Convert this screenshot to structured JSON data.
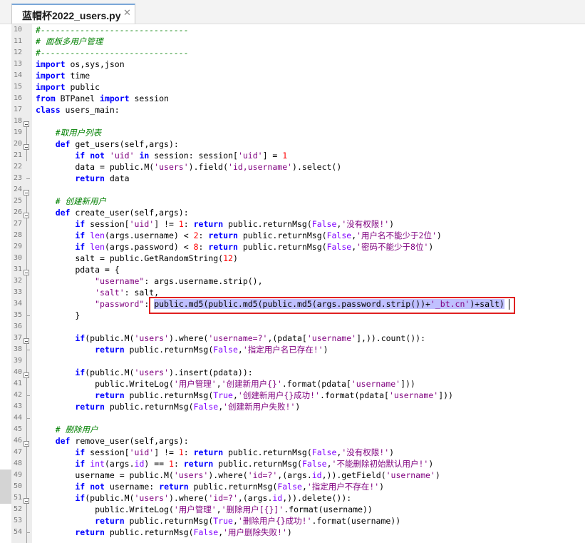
{
  "tab": {
    "title": "蓝帽杯2022_users.py",
    "close_glyph": "✕"
  },
  "gutter": {
    "line_numbers": [
      "10",
      "11",
      "12",
      "13",
      "14",
      "15",
      "16",
      "17",
      "18",
      "19",
      "20",
      "21",
      "22",
      "23",
      "24",
      "25",
      "26",
      "27",
      "28",
      "29",
      "30",
      "31",
      "32",
      "33",
      "34",
      "35",
      "36",
      "37",
      "38",
      "39",
      "40",
      "41",
      "42",
      "43",
      "44",
      "45",
      "46",
      "47",
      "48",
      "49",
      "50",
      "51",
      "52",
      "53",
      "54"
    ]
  },
  "code": {
    "l10": "#------------------------------",
    "l11": "# 面板多用户管理",
    "l12": "#------------------------------",
    "l13a": "import",
    "l13b": " os,sys,json",
    "l14a": "import",
    "l14b": " time",
    "l15a": "import",
    "l15b": " public",
    "l16a": "from",
    "l16b": " BTPanel ",
    "l16c": "import",
    "l16d": " session",
    "l17a": "class",
    "l17b": " users_main:",
    "l19": "    #取用户列表",
    "l20a": "    def",
    "l20b": " get_users(self,args):",
    "l21a": "        if",
    "l21b": " ",
    "l21c": "not",
    "l21d": " ",
    "l21e": "'uid'",
    "l21f": " ",
    "l21g": "in",
    "l21h": " session: session[",
    "l21i": "'uid'",
    "l21j": "] = ",
    "l21k": "1",
    "l22a": "        data = public.M(",
    "l22b": "'users'",
    "l22c": ").field(",
    "l22d": "'id,username'",
    "l22e": ").select()",
    "l23a": "        return",
    "l23b": " data",
    "l25": "    # 创建新用户",
    "l26a": "    def",
    "l26b": " create_user(self,args):",
    "l27a": "        if",
    "l27b": " session[",
    "l27c": "'uid'",
    "l27d": "] != ",
    "l27e": "1",
    "l27f": ": ",
    "l27g": "return",
    "l27h": " public.returnMsg(",
    "l27i": "False",
    "l27j": ",",
    "l27k": "'没有权限!'",
    "l27l": ")",
    "l28a": "        if",
    "l28b": " ",
    "l28c": "len",
    "l28d": "(args.username) < ",
    "l28e": "2",
    "l28f": ": ",
    "l28g": "return",
    "l28h": " public.returnMsg(",
    "l28i": "False",
    "l28j": ",",
    "l28k": "'用户名不能少于2位'",
    "l28l": ")",
    "l29a": "        if",
    "l29b": " ",
    "l29c": "len",
    "l29d": "(args.password) < ",
    "l29e": "8",
    "l29f": ": ",
    "l29g": "return",
    "l29h": " public.returnMsg(",
    "l29i": "False",
    "l29j": ",",
    "l29k": "'密码不能少于8位'",
    "l29l": ")",
    "l30a": "        salt = public.GetRandomString(",
    "l30b": "12",
    "l30c": ")",
    "l31": "        pdata = {",
    "l32a": "            ",
    "l32b": "\"username\"",
    "l32c": ": args.username.strip(),",
    "l33a": "            ",
    "l33b": "'salt'",
    "l33c": ": salt,",
    "l34a": "            ",
    "l34b": "\"password\"",
    "l34c": ": ",
    "l34d": "public.md5(public.md5(public.md5(args.password.strip())+",
    "l34e": "'_bt.cn'",
    "l34f": ")+salt)",
    "l35": "        }",
    "l37a": "        if",
    "l37b": "(public.M(",
    "l37c": "'users'",
    "l37d": ").where(",
    "l37e": "'username=?'",
    "l37f": ",(pdata[",
    "l37g": "'username'",
    "l37h": "],)).count()):",
    "l38a": "            return",
    "l38b": " public.returnMsg(",
    "l38c": "False",
    "l38d": ",",
    "l38e": "'指定用户名已存在!'",
    "l38f": ")",
    "l40a": "        if",
    "l40b": "(public.M(",
    "l40c": "'users'",
    "l40d": ").insert(pdata)):",
    "l41a": "            public.WriteLog(",
    "l41b": "'用户管理'",
    "l41c": ",",
    "l41d": "'创建新用户{}'",
    "l41e": ".format(pdata[",
    "l41f": "'username'",
    "l41g": "]))",
    "l42a": "            return",
    "l42b": " public.returnMsg(",
    "l42c": "True",
    "l42d": ",",
    "l42e": "'创建新用户{}成功!'",
    "l42f": ".format(pdata[",
    "l42g": "'username'",
    "l42h": "]))",
    "l43a": "        return",
    "l43b": " public.returnMsg(",
    "l43c": "False",
    "l43d": ",",
    "l43e": "'创建新用户失败!'",
    "l43f": ")",
    "l45": "    # 删除用户",
    "l46a": "    def",
    "l46b": " remove_user(self,args):",
    "l47a": "        if",
    "l47b": " session[",
    "l47c": "'uid'",
    "l47d": "] != ",
    "l47e": "1",
    "l47f": ": ",
    "l47g": "return",
    "l47h": " public.returnMsg(",
    "l47i": "False",
    "l47j": ",",
    "l47k": "'没有权限!'",
    "l47l": ")",
    "l48a": "        if",
    "l48b": " ",
    "l48c": "int",
    "l48d": "(args.",
    "l48e": "id",
    "l48f": ") == ",
    "l48g": "1",
    "l48h": ": ",
    "l48i": "return",
    "l48j": " public.returnMsg(",
    "l48k": "False",
    "l48l": ",",
    "l48m": "'不能删除初始默认用户!'",
    "l48n": ")",
    "l49a": "        username = public.M(",
    "l49b": "'users'",
    "l49c": ").where(",
    "l49d": "'id=?'",
    "l49e": ",(args.",
    "l49f": "id",
    "l49g": ",)).getField(",
    "l49h": "'username'",
    "l49i": ")",
    "l50a": "        if",
    "l50b": " ",
    "l50c": "not",
    "l50d": " username: ",
    "l50e": "return",
    "l50f": " public.returnMsg(",
    "l50g": "False",
    "l50h": ",",
    "l50i": "'指定用户不存在!'",
    "l50j": ")",
    "l51a": "        if",
    "l51b": "(public.M(",
    "l51c": "'users'",
    "l51d": ").where(",
    "l51e": "'id=?'",
    "l51f": ",(args.",
    "l51g": "id",
    "l51h": ",)).delete()):",
    "l52a": "            public.WriteLog(",
    "l52b": "'用户管理'",
    "l52c": ",",
    "l52d": "'删除用户[{}]'",
    "l52e": ".format(username))",
    "l53a": "            return",
    "l53b": " public.returnMsg(",
    "l53c": "True",
    "l53d": ",",
    "l53e": "'删除用户{}成功!'",
    "l53f": ".format(username))",
    "l54a": "        return",
    "l54b": " public.returnMsg(",
    "l54c": "False",
    "l54d": ",",
    "l54e": "'用户删除失败!'",
    "l54f": ")"
  },
  "colors": {
    "keyword": "#0000ff",
    "comment": "#008000",
    "string": "#7f007f",
    "number": "#ff0000",
    "builtin": "#8000ff",
    "selection": "#c0c0ff",
    "highlight_box": "#e02020"
  }
}
